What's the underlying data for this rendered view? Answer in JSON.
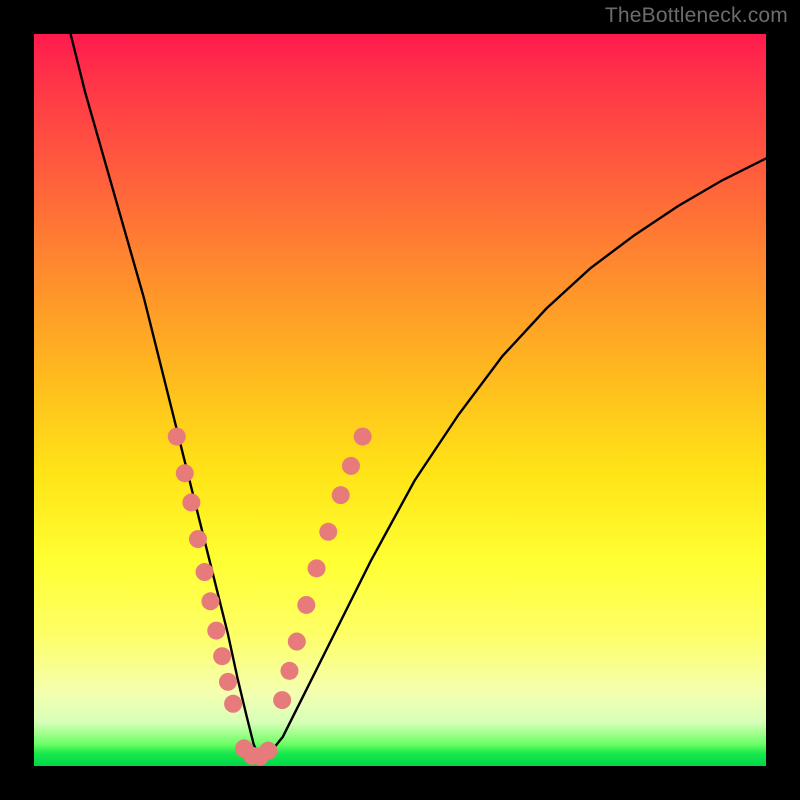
{
  "watermark": "TheBottleneck.com",
  "colors": {
    "curve_stroke": "#000000",
    "dot_fill": "#e77b7b",
    "dot_stroke": "#cf5d5d"
  },
  "chart_data": {
    "type": "line",
    "title": "",
    "xlabel": "",
    "ylabel": "",
    "xlim": [
      0,
      100
    ],
    "ylim": [
      0,
      100
    ],
    "annotations": [],
    "series": [
      {
        "name": "bottleneck-curve",
        "x": [
          5,
          7,
          9,
          11,
          13,
          15,
          17,
          19,
          20.5,
          22,
          23.5,
          25,
          26.5,
          27.8,
          29,
          30,
          30.8,
          32,
          34,
          37,
          41,
          46,
          52,
          58,
          64,
          70,
          76,
          82,
          88,
          94,
          100
        ],
        "y": [
          100,
          92,
          85,
          78,
          71,
          64,
          56,
          48,
          42,
          36,
          30,
          24,
          18,
          12,
          7,
          3,
          1,
          1.5,
          4,
          10,
          18,
          28,
          39,
          48,
          56,
          62.5,
          68,
          72.5,
          76.5,
          80,
          83
        ]
      }
    ],
    "markers": {
      "name": "highlight-dots",
      "left_branch": [
        {
          "x": 19.5,
          "y": 45
        },
        {
          "x": 20.6,
          "y": 40
        },
        {
          "x": 21.5,
          "y": 36
        },
        {
          "x": 22.4,
          "y": 31
        },
        {
          "x": 23.3,
          "y": 26.5
        },
        {
          "x": 24.1,
          "y": 22.5
        },
        {
          "x": 24.9,
          "y": 18.5
        },
        {
          "x": 25.7,
          "y": 15
        },
        {
          "x": 26.5,
          "y": 11.5
        },
        {
          "x": 27.2,
          "y": 8.5
        }
      ],
      "trough": [
        {
          "x": 28.7,
          "y": 2.4
        },
        {
          "x": 29.8,
          "y": 1.4
        },
        {
          "x": 30.9,
          "y": 1.3
        },
        {
          "x": 32.0,
          "y": 2.1
        }
      ],
      "right_branch": [
        {
          "x": 33.9,
          "y": 9
        },
        {
          "x": 34.9,
          "y": 13
        },
        {
          "x": 35.9,
          "y": 17
        },
        {
          "x": 37.2,
          "y": 22
        },
        {
          "x": 38.6,
          "y": 27
        },
        {
          "x": 40.2,
          "y": 32
        },
        {
          "x": 41.9,
          "y": 37
        },
        {
          "x": 43.3,
          "y": 41
        },
        {
          "x": 44.9,
          "y": 45
        }
      ]
    }
  }
}
